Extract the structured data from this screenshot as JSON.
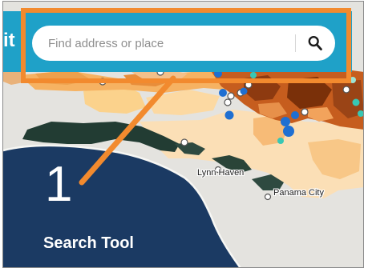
{
  "app": {
    "title_fragment": "it"
  },
  "search": {
    "placeholder": "Find address or place",
    "value": "",
    "button_icon": "search-icon"
  },
  "callout": {
    "number": "1",
    "label": "Search Tool",
    "highlight_color": "#f28a2e"
  },
  "map": {
    "place_labels": [
      "Lynn Haven",
      "Panama City"
    ]
  },
  "colors": {
    "header": "#1fa1c8",
    "water": "#1b3a63",
    "callout": "#f28a2e"
  }
}
